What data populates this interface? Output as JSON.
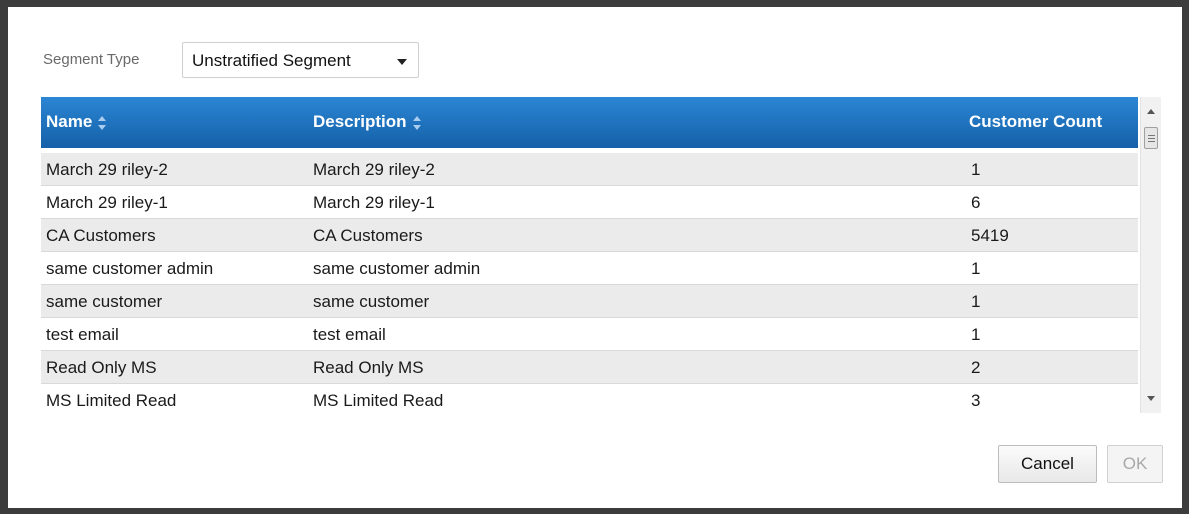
{
  "segment_type": {
    "label": "Segment Type",
    "selected": "Unstratified Segment"
  },
  "grid": {
    "columns": {
      "name": "Name",
      "description": "Description",
      "count": "Customer Count"
    },
    "rows": [
      {
        "name": "March 29 riley-2",
        "description": "March 29 riley-2",
        "count": "1"
      },
      {
        "name": "March 29 riley-1",
        "description": "March 29 riley-1",
        "count": "6"
      },
      {
        "name": "CA Customers",
        "description": "CA Customers",
        "count": "5419"
      },
      {
        "name": "same customer admin",
        "description": "same customer admin",
        "count": "1"
      },
      {
        "name": "same customer",
        "description": "same customer",
        "count": "1"
      },
      {
        "name": "test email",
        "description": "test email",
        "count": "1"
      },
      {
        "name": "Read Only MS",
        "description": "Read Only MS",
        "count": "2"
      },
      {
        "name": "MS Limited Read",
        "description": "MS Limited Read",
        "count": "3"
      }
    ]
  },
  "buttons": {
    "cancel": "Cancel",
    "ok": "OK"
  }
}
